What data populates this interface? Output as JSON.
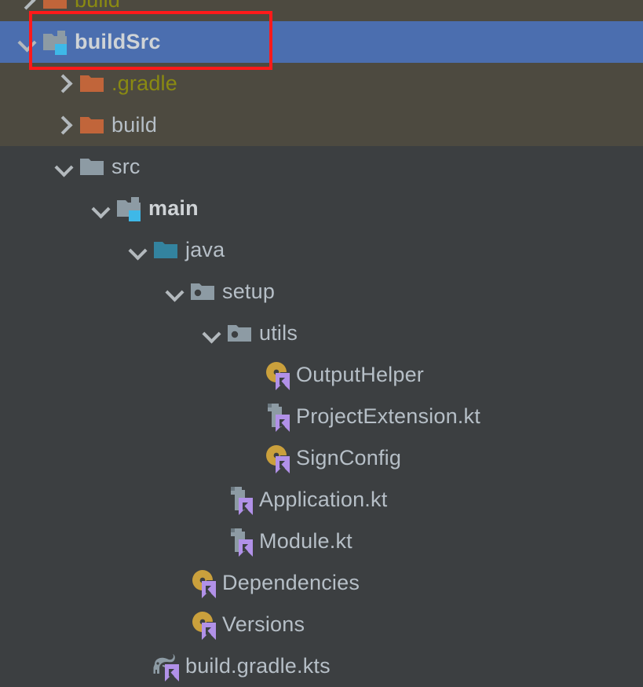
{
  "panel": {
    "name": "project-tree",
    "background_excluded": "#4d4a40",
    "background_normal": "#3c3f41",
    "selection_color": "#4b6eaf",
    "highlight_color": "#ff1a1a",
    "text_color": "#b6bfc7",
    "excluded_text_color": "#8a8a12"
  },
  "rows": [
    {
      "label": "build",
      "icon": "orange-folder-icon",
      "chevron": "chevron-right-icon",
      "depth": 1,
      "state": "collapsed",
      "background": "excluded",
      "text_style": "olive",
      "partial": true
    },
    {
      "label": "buildSrc",
      "icon": "module-folder-icon",
      "chevron": "chevron-down-icon",
      "depth": 1,
      "state": "expanded",
      "background": "selected",
      "text_style": "bold",
      "selected": true,
      "highlighted": true
    },
    {
      "label": ".gradle",
      "icon": "orange-folder-icon",
      "chevron": "chevron-right-icon",
      "depth": 2,
      "state": "collapsed",
      "background": "excluded",
      "text_style": "olive"
    },
    {
      "label": "build",
      "icon": "orange-folder-icon",
      "chevron": "chevron-right-icon",
      "depth": 2,
      "state": "collapsed",
      "background": "excluded",
      "text_style": "normal"
    },
    {
      "label": "src",
      "icon": "gray-folder-icon",
      "chevron": "chevron-down-icon",
      "depth": 2,
      "state": "expanded",
      "background": "normal",
      "text_style": "normal"
    },
    {
      "label": "main",
      "icon": "module-folder-icon",
      "chevron": "chevron-down-icon",
      "depth": 3,
      "state": "expanded",
      "background": "normal",
      "text_style": "bold"
    },
    {
      "label": "java",
      "icon": "source-root-folder-icon",
      "chevron": "chevron-down-icon",
      "depth": 4,
      "state": "expanded",
      "background": "normal",
      "text_style": "normal"
    },
    {
      "label": "setup",
      "icon": "package-folder-icon",
      "chevron": "chevron-down-icon",
      "depth": 5,
      "state": "expanded",
      "background": "normal",
      "text_style": "normal"
    },
    {
      "label": "utils",
      "icon": "package-folder-icon",
      "chevron": "chevron-down-icon",
      "depth": 6,
      "state": "expanded",
      "background": "normal",
      "text_style": "normal"
    },
    {
      "label": "OutputHelper",
      "icon": "kotlin-object-icon",
      "chevron": "none",
      "depth": 7,
      "state": "leaf",
      "background": "normal",
      "text_style": "normal"
    },
    {
      "label": "ProjectExtension.kt",
      "icon": "kotlin-file-icon",
      "chevron": "none",
      "depth": 7,
      "state": "leaf",
      "background": "normal",
      "text_style": "normal"
    },
    {
      "label": "SignConfig",
      "icon": "kotlin-object-icon",
      "chevron": "none",
      "depth": 7,
      "state": "leaf",
      "background": "normal",
      "text_style": "normal"
    },
    {
      "label": "Application.kt",
      "icon": "kotlin-file-icon",
      "chevron": "none",
      "depth": 6,
      "state": "leaf",
      "background": "normal",
      "text_style": "normal"
    },
    {
      "label": "Module.kt",
      "icon": "kotlin-file-icon",
      "chevron": "none",
      "depth": 6,
      "state": "leaf",
      "background": "normal",
      "text_style": "normal"
    },
    {
      "label": "Dependencies",
      "icon": "kotlin-object-icon",
      "chevron": "none",
      "depth": 5,
      "state": "leaf",
      "background": "normal",
      "text_style": "normal"
    },
    {
      "label": "Versions",
      "icon": "kotlin-object-icon",
      "chevron": "none",
      "depth": 5,
      "state": "leaf",
      "background": "normal",
      "text_style": "normal"
    },
    {
      "label": "build.gradle.kts",
      "icon": "gradle-kts-icon",
      "chevron": "none",
      "depth": 4,
      "state": "leaf",
      "background": "normal",
      "text_style": "normal"
    }
  ]
}
